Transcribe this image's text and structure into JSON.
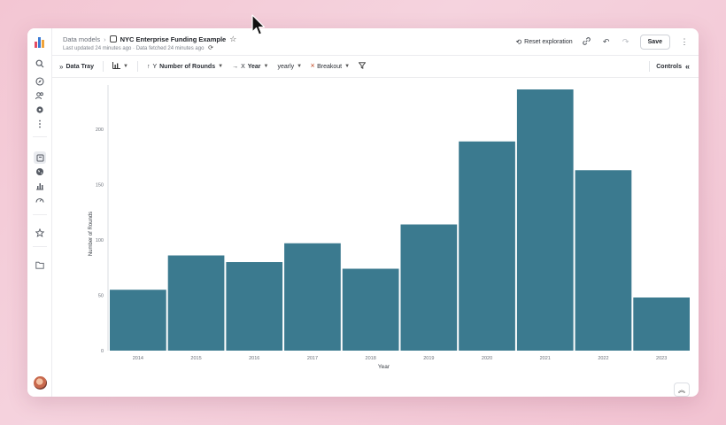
{
  "header": {
    "breadcrumb_parent": "Data models",
    "separator": "›",
    "title": "NYC Enterprise Funding Example",
    "subline": "Last updated 24 minutes ago · Data fetched 24 minutes ago",
    "reset_label": "Reset exploration",
    "save_label": "Save"
  },
  "toolbar": {
    "data_tray_label": "Data Tray",
    "y_label": "Y",
    "y_field": "Number of Rounds",
    "x_label": "X",
    "x_field": "Year",
    "granularity": "yearly",
    "breakout_label": "Breakout",
    "controls_label": "Controls"
  },
  "icons": {
    "nav": [
      "search-icon",
      "compass-icon",
      "users-icon",
      "settings-icon",
      "more-icon",
      "book-icon",
      "globe-icon",
      "chart-icon",
      "gauge-icon",
      "star-icon",
      "folder-icon"
    ],
    "toolbar": [
      "chevrons-right-icon",
      "chart-type-icon",
      "arrow-up-icon",
      "arrow-right-icon",
      "breakout-icon",
      "filter-icon"
    ],
    "header": [
      "model-icon",
      "star-icon",
      "refresh-icon",
      "link-icon",
      "undo-icon",
      "redo-icon",
      "kebab-icon"
    ]
  },
  "colors": {
    "bar": "#3b7a8f",
    "accent": "#1d2026",
    "logo": [
      "#e34d63",
      "#3a7bd5",
      "#f0a33a"
    ]
  },
  "chart_data": {
    "type": "bar",
    "categories": [
      "2014",
      "2015",
      "2016",
      "2017",
      "2018",
      "2019",
      "2020",
      "2021",
      "2022",
      "2023"
    ],
    "values": [
      55,
      86,
      80,
      97,
      74,
      114,
      189,
      236,
      163,
      48
    ],
    "xlabel": "Year",
    "ylabel": "Number of Rounds",
    "ylim": [
      0,
      240
    ],
    "yticks": [
      0,
      50,
      100,
      150,
      200
    ],
    "ytick_labels": [
      "0",
      "50",
      "100",
      "150",
      "200"
    ],
    "grid": false
  }
}
